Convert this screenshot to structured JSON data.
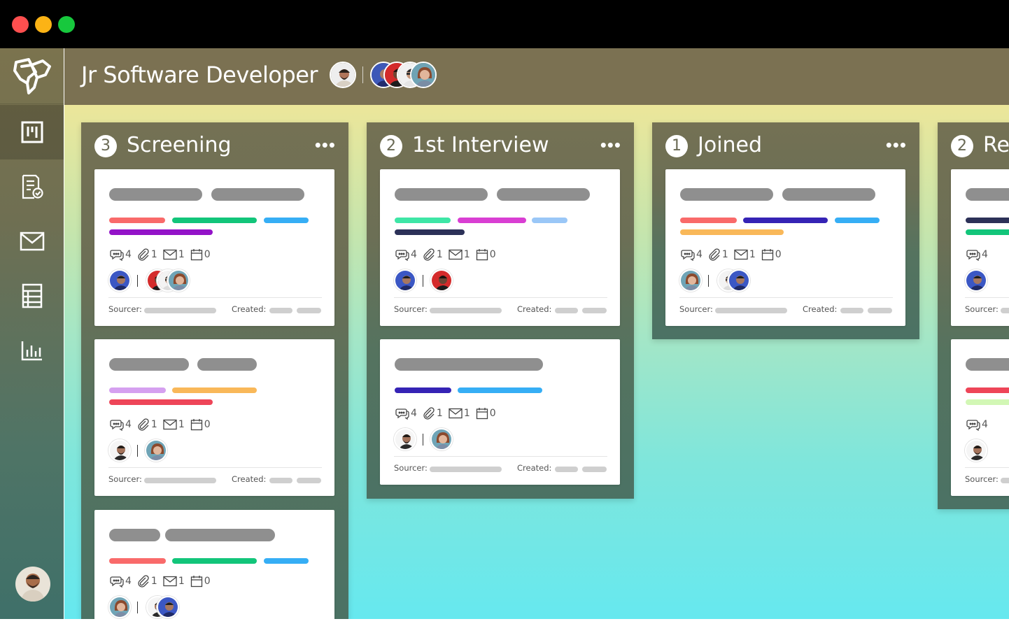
{
  "window": {
    "controls": [
      "close",
      "minimize",
      "maximize"
    ]
  },
  "app": {
    "logo_icon": "tr-logo-icon"
  },
  "header": {
    "title": "Jr Software Developer"
  },
  "sidebar": {
    "items": [
      {
        "name": "pipeline-board",
        "icon": "kanban-board-icon",
        "active": true
      },
      {
        "name": "tasks",
        "icon": "checklist-icon",
        "active": false
      },
      {
        "name": "messages",
        "icon": "mail-icon",
        "active": false
      },
      {
        "name": "list",
        "icon": "list-icon",
        "active": false
      },
      {
        "name": "reports",
        "icon": "bar-chart-icon",
        "active": false
      }
    ]
  },
  "columns": [
    {
      "count": "3",
      "title": "Screening",
      "more": "•••",
      "cards": [
        {
          "stats": {
            "comments": "4",
            "attachments": "1",
            "emails": "1",
            "events": "0"
          },
          "sourcer_label": "Sourcer:",
          "created_label": "Created:"
        },
        {
          "stats": {
            "comments": "4",
            "attachments": "1",
            "emails": "1",
            "events": "0"
          },
          "sourcer_label": "Sourcer:",
          "created_label": "Created:"
        },
        {
          "stats": {
            "comments": "4",
            "attachments": "1",
            "emails": "1",
            "events": "0"
          }
        }
      ]
    },
    {
      "count": "2",
      "title": "1st Interview",
      "more": "•••",
      "cards": [
        {
          "stats": {
            "comments": "4",
            "attachments": "1",
            "emails": "1",
            "events": "0"
          },
          "sourcer_label": "Sourcer:",
          "created_label": "Created:"
        },
        {
          "stats": {
            "comments": "4",
            "attachments": "1",
            "emails": "1",
            "events": "0"
          },
          "sourcer_label": "Sourcer:",
          "created_label": "Created:"
        }
      ]
    },
    {
      "count": "1",
      "title": "Joined",
      "more": "•••",
      "cards": [
        {
          "stats": {
            "comments": "4",
            "attachments": "1",
            "emails": "1",
            "events": "0"
          },
          "sourcer_label": "Sourcer:",
          "created_label": "Created:"
        }
      ]
    },
    {
      "count": "2",
      "title": "Re",
      "cards": [
        {
          "stats": {
            "comments": "4"
          },
          "sourcer_label": "Sourcer:"
        },
        {
          "stats": {
            "comments": "4"
          },
          "sourcer_label": "Sourcer:"
        }
      ]
    }
  ],
  "colors": {
    "coral": "#f96a6a",
    "green": "#12c57a",
    "blue": "#36aef5",
    "purple": "#9313c8",
    "teal": "#3ee6a6",
    "magenta": "#d93ed3",
    "light-blue": "#9ac7f7",
    "navy": "#2c3158",
    "indigo": "#3523b5",
    "orange": "#f9b859",
    "lavender": "#d5a0f0",
    "red": "#ee4558",
    "light-green": "#d2f7b5"
  }
}
